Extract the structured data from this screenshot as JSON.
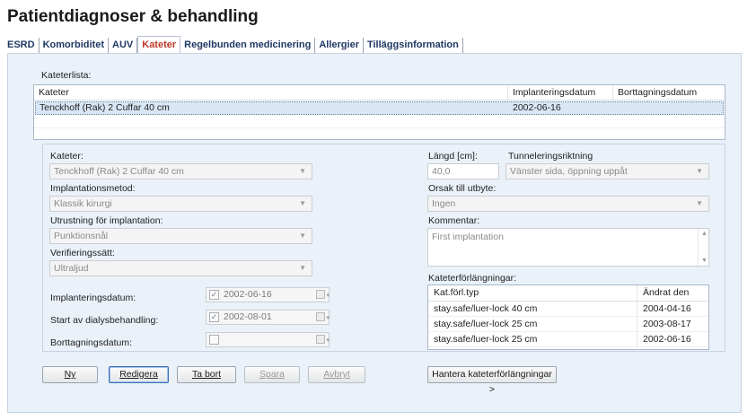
{
  "page": {
    "title": "Patientdiagnoser & behandling"
  },
  "tabs": [
    "ESRD",
    "Komorbiditet",
    "AUV",
    "Kateter",
    "Regelbunden medicinering",
    "Allergier",
    "Tilläggsinformation"
  ],
  "catheter_list": {
    "label": "Kateterlista:",
    "headers": [
      "Kateter",
      "Implanteringsdatum",
      "Borttagningsdatum"
    ],
    "rows": [
      {
        "name": "Tenckhoff (Rak) 2 Cuffar 40 cm",
        "implant_date": "2002-06-16",
        "removal_date": ""
      }
    ]
  },
  "form": {
    "catheter_label": "Kateter:",
    "catheter_value": "Tenckhoff (Rak) 2 Cuffar 40 cm",
    "method_label": "Implantationsmetod:",
    "method_value": "Klassik kirurgi",
    "equipment_label": "Utrustning för implantation:",
    "equipment_value": "Punktionsnål",
    "verification_label": "Verifieringssätt:",
    "verification_value": "Ultraljud",
    "implant_date_label": "Implanteringsdatum:",
    "implant_date_value": "2002-06-16",
    "dialysis_start_label": "Start av dialysbehandling:",
    "dialysis_start_value": "2002-08-01",
    "removal_date_label": "Borttagningsdatum:",
    "removal_date_value": "",
    "length_label": "Längd [cm]:",
    "length_value": "40,0",
    "tunnel_label": "Tunneleringsriktning",
    "tunnel_value": "Vänster sida, öppning uppåt",
    "removal_reason_label": "Orsak till utbyte:",
    "removal_reason_value": "Ingen",
    "comment_label": "Kommentar:",
    "comment_value": "First implantation",
    "extensions_label": "Kateterförlängningar:"
  },
  "extensions": {
    "headers": [
      "Kat.förl.typ",
      "Ändrat den"
    ],
    "rows": [
      {
        "type": "stay.safe/luer-lock 40 cm",
        "changed": "2004-04-16"
      },
      {
        "type": "stay.safe/luer-lock 25 cm",
        "changed": "2003-08-17"
      },
      {
        "type": "stay.safe/luer-lock 25 cm",
        "changed": "2002-06-16"
      }
    ]
  },
  "buttons": {
    "new": "Ny",
    "edit": "Redigera",
    "delete": "Ta bort",
    "save": "Spara",
    "cancel": "Avbryt",
    "manage_extensions": "Hantera kateterförlängningar >"
  }
}
